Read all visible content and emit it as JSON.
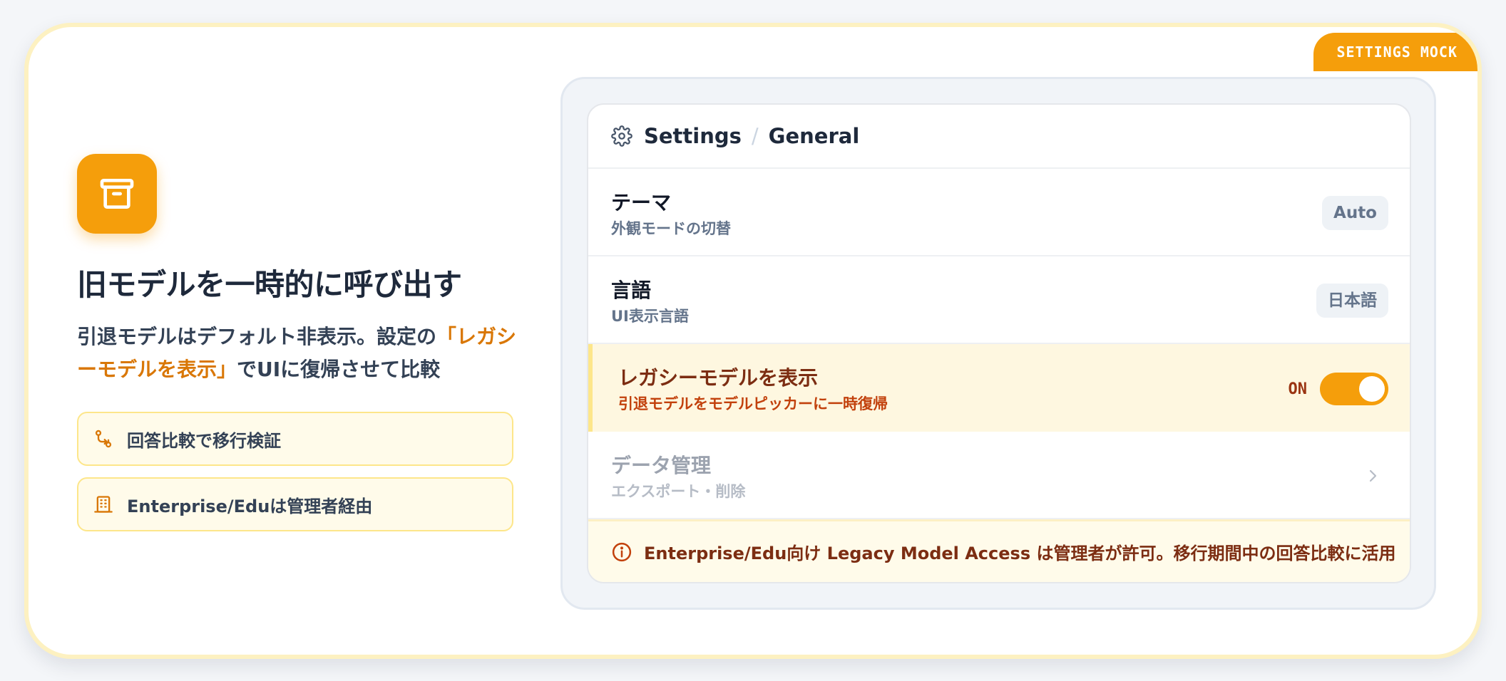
{
  "badge": "SETTINGS MOCK",
  "left": {
    "icon": "archive-box-icon",
    "title": "旧モデルを一時的に呼び出す",
    "desc_part1": "引退モデルはデフォルト非表示。設定の",
    "desc_highlight": "「レガシーモデルを表示」",
    "desc_part2": "でUIに復帰させて比較",
    "features": [
      {
        "icon": "compare-branch-icon",
        "label": "回答比較で移行検証"
      },
      {
        "icon": "building-icon",
        "label": "Enterprise/Eduは管理者経由"
      }
    ]
  },
  "settings": {
    "header_icon": "gear-icon",
    "breadcrumb": [
      "Settings",
      "General"
    ],
    "breadcrumb_separator": "/",
    "rows": [
      {
        "title": "テーマ",
        "subtitle": "外観モードの切替",
        "value": "Auto"
      },
      {
        "title": "言語",
        "subtitle": "UI表示言語",
        "value": "日本語"
      },
      {
        "title": "レガシーモデルを表示",
        "subtitle": "引退モデルをモデルピッカーに一時復帰",
        "toggle_label": "ON",
        "toggle_on": true
      },
      {
        "title": "データ管理",
        "subtitle": "エクスポート・削除",
        "icon": "chevron-right-icon"
      }
    ],
    "notice": {
      "icon": "info-circle-icon",
      "text": "Enterprise/Edu向け Legacy Model Access は管理者が許可。移行期間中の回答比較に活用"
    }
  },
  "colors": {
    "accent": "#f59e0b",
    "accent_text": "#d97706",
    "title_text": "#1e293b",
    "highlight_row_bg": "#fef7e0",
    "border_soft": "#fde68a"
  }
}
